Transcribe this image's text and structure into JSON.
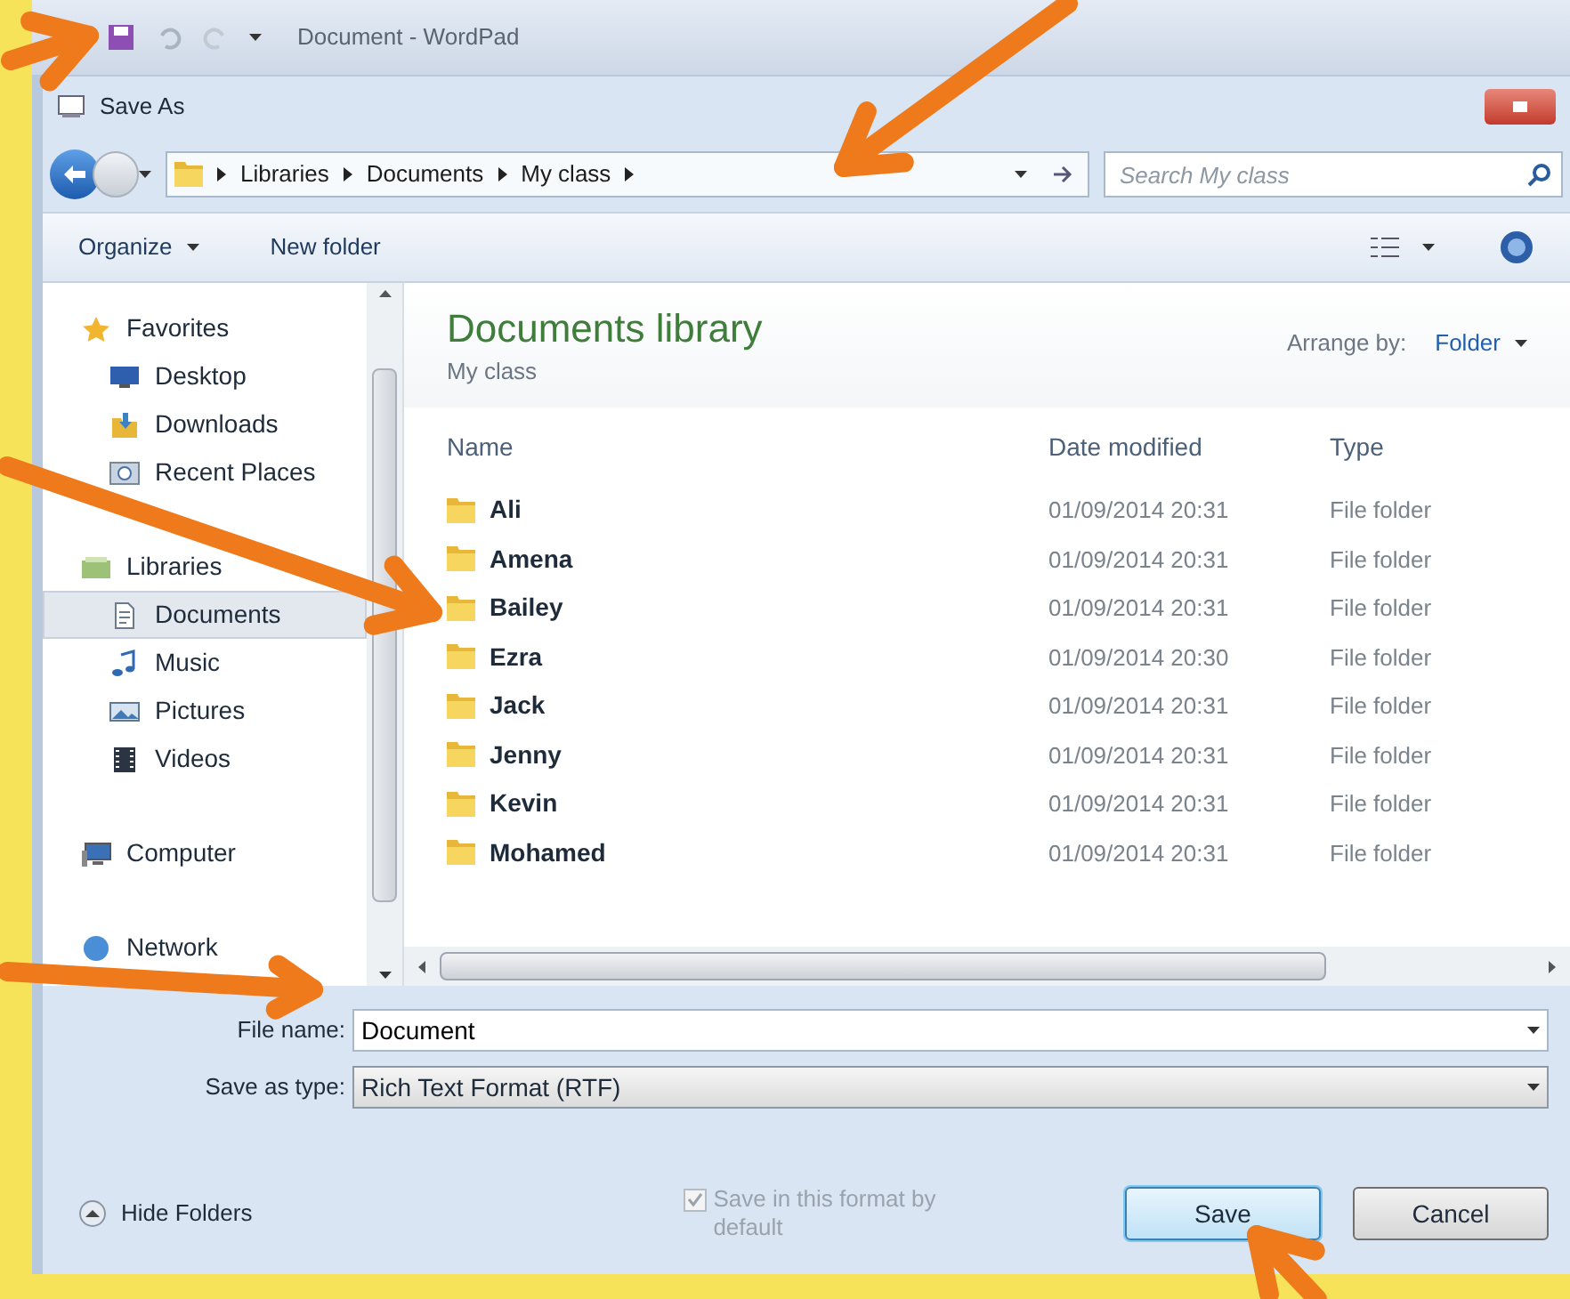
{
  "wordpad": {
    "title": "Document - WordPad"
  },
  "dialog": {
    "title": "Save As"
  },
  "breadcrumb": [
    "Libraries",
    "Documents",
    "My class"
  ],
  "search": {
    "placeholder": "Search My class"
  },
  "toolbar": {
    "organize": "Organize",
    "new_folder": "New folder"
  },
  "sidebar": [
    {
      "label": "Favorites",
      "kind": "star",
      "children": [
        {
          "label": "Desktop",
          "kind": "desktop",
          "selected": false
        },
        {
          "label": "Downloads",
          "kind": "download",
          "selected": false
        },
        {
          "label": "Recent Places",
          "kind": "recent",
          "selected": false
        }
      ]
    },
    {
      "label": "Libraries",
      "kind": "library",
      "children": [
        {
          "label": "Documents",
          "kind": "document",
          "selected": true
        },
        {
          "label": "Music",
          "kind": "music",
          "selected": false
        },
        {
          "label": "Pictures",
          "kind": "pictures",
          "selected": false
        },
        {
          "label": "Videos",
          "kind": "video",
          "selected": false
        }
      ]
    },
    {
      "label": "Computer",
      "kind": "computer"
    },
    {
      "label": "Network",
      "kind": "network"
    }
  ],
  "library": {
    "title": "Documents library",
    "subtitle": "My class",
    "arrange_label": "Arrange by:",
    "arrange_value": "Folder"
  },
  "table": {
    "columns": [
      "Name",
      "Date modified",
      "Type"
    ],
    "rows": [
      {
        "name": "Ali",
        "date": "01/09/2014 20:31",
        "type": "File folder"
      },
      {
        "name": "Amena",
        "date": "01/09/2014 20:31",
        "type": "File folder"
      },
      {
        "name": "Bailey",
        "date": "01/09/2014 20:31",
        "type": "File folder"
      },
      {
        "name": "Ezra",
        "date": "01/09/2014 20:30",
        "type": "File folder"
      },
      {
        "name": "Jack",
        "date": "01/09/2014 20:31",
        "type": "File folder"
      },
      {
        "name": "Jenny",
        "date": "01/09/2014 20:31",
        "type": "File folder"
      },
      {
        "name": "Kevin",
        "date": "01/09/2014 20:31",
        "type": "File folder"
      },
      {
        "name": "Mohamed",
        "date": "01/09/2014 20:31",
        "type": "File folder"
      }
    ]
  },
  "file_name": {
    "label": "File name:",
    "value": "Document"
  },
  "save_type": {
    "label": "Save as type:",
    "value": "Rich Text Format (RTF)"
  },
  "default_option": {
    "label": "Save in this format by default",
    "checked": true,
    "disabled": true
  },
  "hide_folders": "Hide Folders",
  "buttons": [
    {
      "label": "Save",
      "kind": "default"
    },
    {
      "label": "Cancel",
      "kind": "normal"
    }
  ]
}
